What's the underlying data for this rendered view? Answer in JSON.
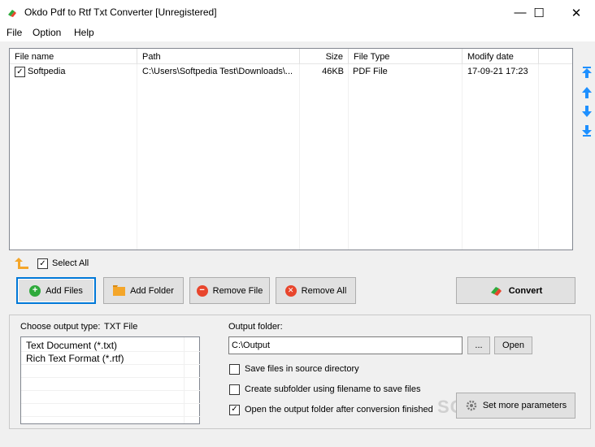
{
  "window": {
    "title": "Okdo Pdf to Rtf Txt Converter [Unregistered]",
    "min_glyph": "—",
    "max_glyph": "☐",
    "close_glyph": "✕"
  },
  "menu": [
    "File",
    "Option",
    "Help"
  ],
  "table": {
    "columns": [
      "File name",
      "Path",
      "Size",
      "File Type",
      "Modify date"
    ],
    "rows": [
      {
        "checked": true,
        "name": "Softpedia",
        "path": "C:\\Users\\Softpedia Test\\Downloads\\...",
        "size": "46KB",
        "type": "PDF File",
        "date": "17-09-21 17:23"
      }
    ]
  },
  "side_arrows": [
    "move-to-top-icon",
    "move-up-icon",
    "move-down-icon",
    "move-to-bottom-icon"
  ],
  "select_all": {
    "label": "Select All",
    "checked": true
  },
  "buttons": {
    "add_files": "Add Files",
    "add_folder": "Add Folder",
    "remove_file": "Remove File",
    "remove_all": "Remove All",
    "convert": "Convert"
  },
  "output": {
    "type_label": "Choose output type:",
    "type_value": "TXT File",
    "types": [
      "Text Document (*.txt)",
      "Rich Text Format (*.rtf)"
    ],
    "folder_label": "Output folder:",
    "folder_value": "C:\\Output",
    "browse_label": "...",
    "open_label": "Open",
    "options": [
      {
        "label": "Save files in source directory",
        "checked": false
      },
      {
        "label": "Create subfolder using filename to save files",
        "checked": false
      },
      {
        "label": "Open the output folder after conversion finished",
        "checked": true
      }
    ],
    "params_label": "Set more parameters"
  },
  "watermark": "SOFTPEDIA",
  "colors": {
    "accent": "#0078d7",
    "arrow_blue": "#1e90ff",
    "add_green": "#2eaa3c",
    "remove_red": "#e8452c",
    "folder_orange": "#f4a62a"
  }
}
